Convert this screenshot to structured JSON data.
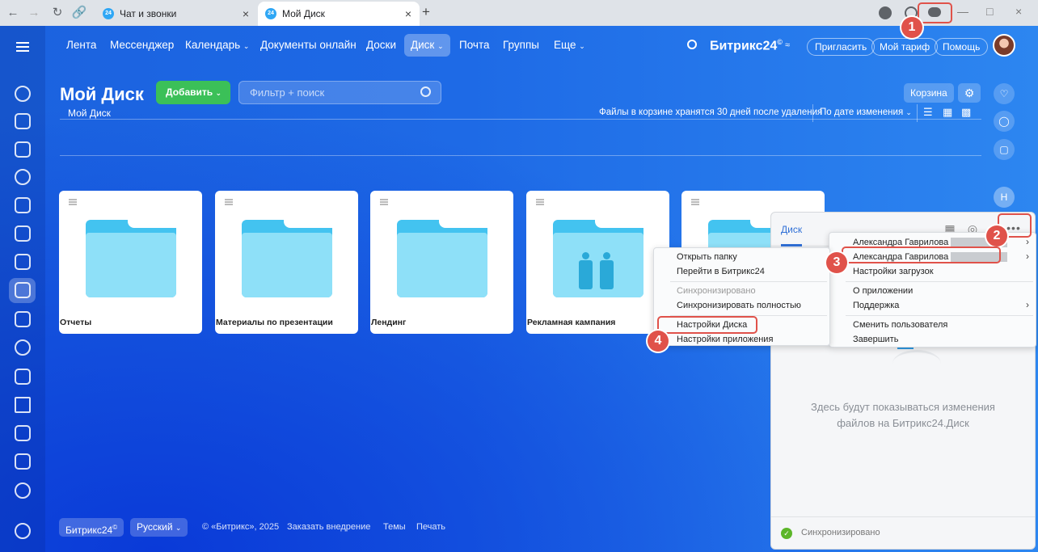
{
  "browser": {
    "tabs": [
      {
        "label": "Чат и звонки",
        "favicon": "24"
      },
      {
        "label": "Мой Диск",
        "favicon": "24"
      }
    ]
  },
  "topnav": {
    "items": [
      "Лента",
      "Мессенджер",
      "Календарь",
      "Документы онлайн",
      "Доски",
      "Диск",
      "Почта",
      "Группы",
      "Еще"
    ],
    "active": "Диск",
    "brand": "Битрикс24",
    "brand_suffix": "©",
    "invite": "Пригласить",
    "tariff": "Мой тариф",
    "help": "Помощь"
  },
  "page": {
    "title": "Мой Диск",
    "add_button": "Добавить",
    "search_placeholder": "Фильтр + поиск",
    "trash_button": "Корзина",
    "breadcrumb": "Мой Диск",
    "trash_note": "Файлы в корзине хранятся 30 дней после удаления",
    "sort_label": "По дате изменения"
  },
  "rail": {
    "avatar_letter": "Н"
  },
  "folders": [
    {
      "name": "Отчеты",
      "shared": false
    },
    {
      "name": "Материалы по презентации",
      "shared": false
    },
    {
      "name": "Лендинг",
      "shared": false
    },
    {
      "name": "Рекламная кампания",
      "shared": true
    },
    {
      "name": "",
      "shared": false
    }
  ],
  "footer": {
    "brand": "Битрикс24",
    "brand_suffix": "©",
    "language": "Русский",
    "copyright": "© «Битрикс», 2025",
    "order": "Заказать внедрение",
    "themes": "Темы",
    "print": "Печать"
  },
  "disk_app": {
    "title": "Диск",
    "empty_line1": "Здесь будут показываться изменения",
    "empty_line2": "файлов на Битрикс24.Диск",
    "status": "Синхронизировано"
  },
  "folder_menu": {
    "items": [
      "Открыть папку",
      "Перейти в Битрикс24",
      "Синхронизировано",
      "Синхронизировать полностью",
      "Настройки Диска",
      "Настройки приложения"
    ]
  },
  "account_menu": {
    "items": [
      "Александра Гаврилова",
      "Александра Гаврилова",
      "Настройки загрузок",
      "О приложении",
      "Поддержка",
      "Сменить пользователя",
      "Завершить"
    ]
  },
  "callouts": [
    "1",
    "2",
    "3",
    "4"
  ],
  "colors": {
    "accent_green": "#3bc058",
    "callout_red": "#e0524a",
    "disk_blue": "#2f6fd6",
    "folder_blue": "#43c3f0"
  }
}
